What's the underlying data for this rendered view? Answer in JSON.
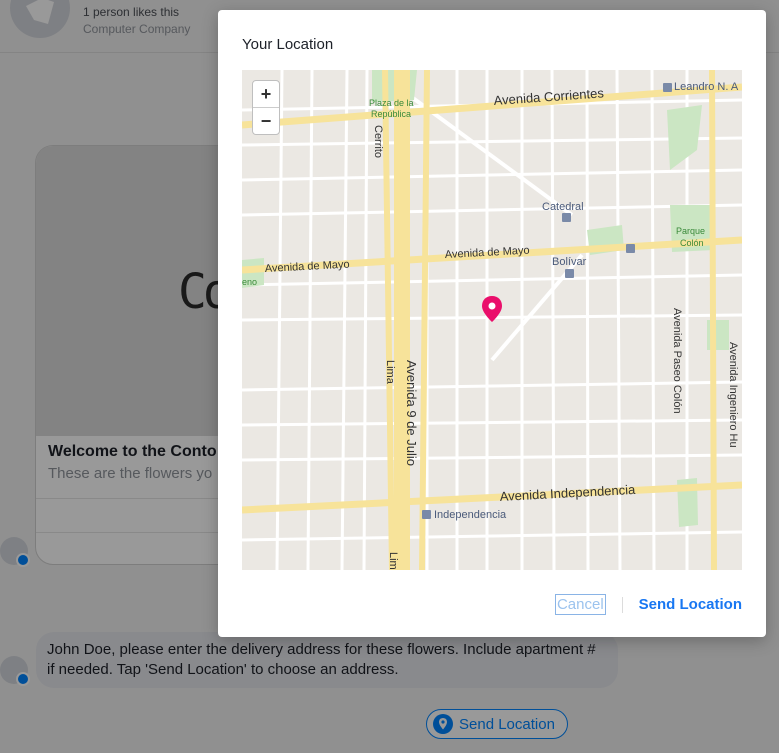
{
  "header": {
    "likes": "1 person likes this",
    "category": "Computer Company"
  },
  "card": {
    "image_text": "Co",
    "title": "Welcome to the Conto",
    "subtitle": "These are the flowers yo"
  },
  "message": {
    "text": "John Doe, please enter the delivery address for these flowers. Include apartment # if needed. Tap 'Send Location' to choose an address."
  },
  "quick_reply": {
    "label": "Send Location"
  },
  "modal": {
    "title": "Your Location",
    "cancel_label": "Cancel",
    "send_label": "Send Location"
  },
  "map": {
    "zoom_in": "+",
    "zoom_out": "−",
    "labels": {
      "corrientes": "Avenida  Corrientes",
      "plaza": "Plaza de la",
      "plaza2": "República",
      "leandro": "Leandro N. A",
      "cerrito": "Cerrito",
      "catedral": "Catedral",
      "parque": "Parque",
      "parque2": "Colón",
      "mayo_left": "Avenida  de  Mayo",
      "mayo_right": "Avenida  de  Mayo",
      "bolivar": "Bolívar",
      "eno": "eno",
      "lima": "Lima",
      "nueve_julio": "Avenida  9  de  Julio",
      "paseo_colon": "Avenida  Paseo  Colón",
      "ingeniero": "Avenida  Ingeniero  Hu",
      "independencia_ave": "Avenida  Independencia",
      "independencia_st": "Independencia",
      "lima2": "Lim"
    },
    "pin_color": "#ea0f6b"
  }
}
